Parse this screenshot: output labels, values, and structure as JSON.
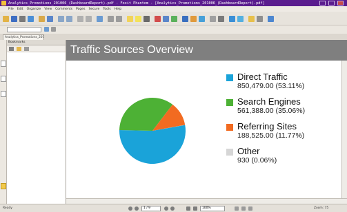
{
  "window": {
    "title": "Analytics_Promotions_201006_(DashboardReport).pdf - Foxit Phantom - [Analytics_Promotions_201006_(DashboardReport).pdf]"
  },
  "menu": [
    "File",
    "Edit",
    "Organize",
    "View",
    "Comments",
    "Pages",
    "Secure",
    "Tools",
    "Help"
  ],
  "tabs": [
    {
      "label": "Analytics_Promotions_201006_(..."
    }
  ],
  "bookmarks_panel": {
    "header": "Bookmarks"
  },
  "report": {
    "title": "Traffic Sources Overview"
  },
  "chart_data": {
    "type": "pie",
    "title": "Traffic Sources Overview",
    "categories": [
      "Direct Traffic",
      "Search Engines",
      "Referring Sites",
      "Other"
    ],
    "values": [
      850479.0,
      561388.0,
      188525.0,
      930
    ],
    "labels": [
      "850,479.00 (53.11%)",
      "561,388.00 (35.06%)",
      "188,525.00 (11.77%)",
      "930 (0.06%)"
    ],
    "percent": [
      53.11,
      35.06,
      11.77,
      0.06
    ],
    "colors": [
      "#1aa3d9",
      "#4db135",
      "#f26b21",
      "#d6d6d6"
    ],
    "legend_position": "right"
  },
  "statusbar": {
    "left": "Ready",
    "page": "1 / 9",
    "zoom": "100%",
    "right_zoom": "Zoom: 75"
  }
}
